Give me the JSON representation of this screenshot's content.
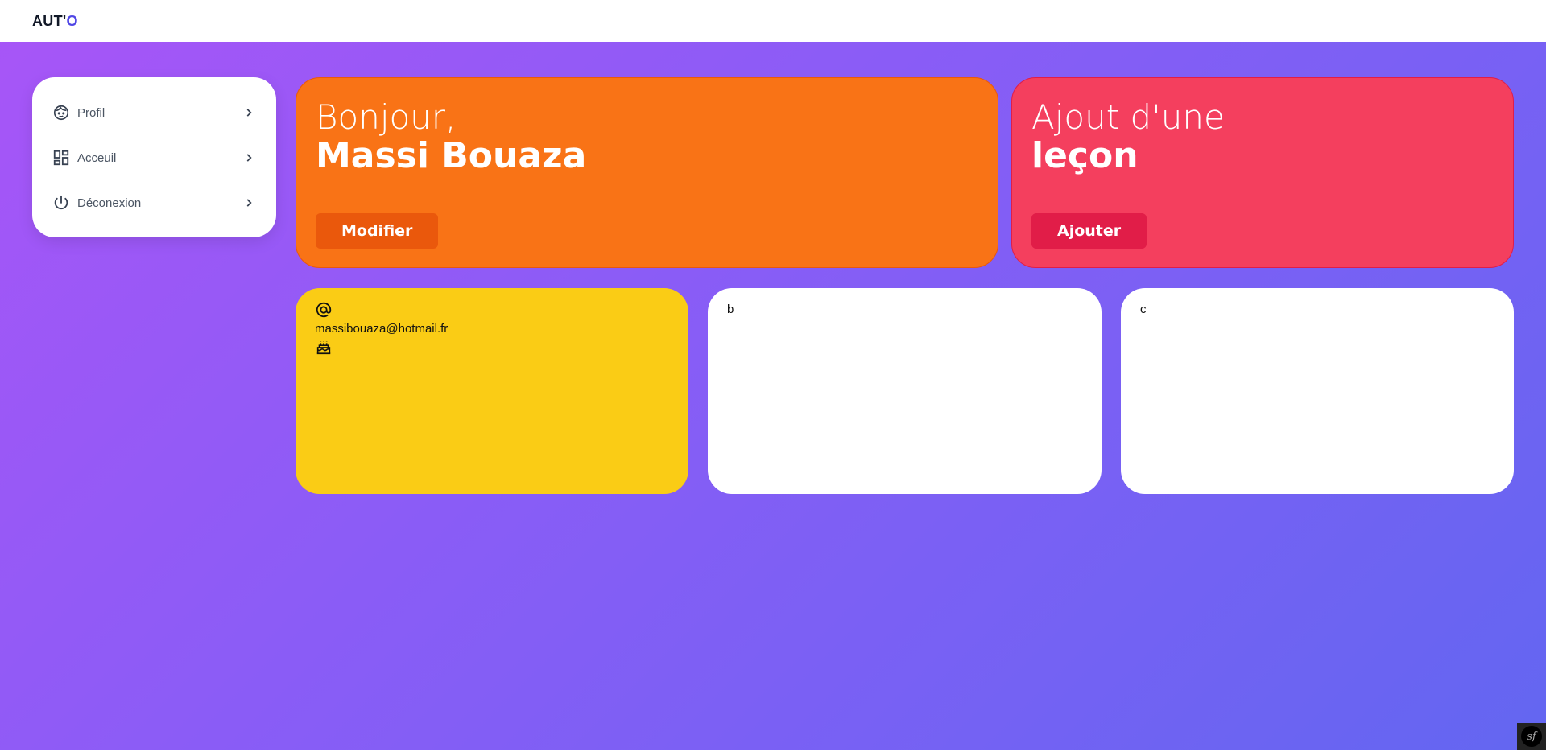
{
  "header": {
    "logo_main": "AUT'",
    "logo_accent": "O"
  },
  "sidebar": {
    "items": [
      {
        "label": "Profil",
        "icon": "face-icon"
      },
      {
        "label": "Acceuil",
        "icon": "dashboard-icon"
      },
      {
        "label": "Déconexion",
        "icon": "power-icon"
      }
    ]
  },
  "greeting": {
    "line1": "Bonjour,",
    "name": "Massi Bouaza",
    "button": "Modifier"
  },
  "lesson": {
    "line1": "Ajout d'une",
    "line2": "leçon",
    "button": "Ajouter"
  },
  "info": {
    "email": "massibouaza@hotmail.fr"
  },
  "card_b": {
    "text": "b"
  },
  "card_c": {
    "text": "c"
  },
  "colors": {
    "orange": "#f97316",
    "red": "#f43f5e",
    "yellow": "#facc15",
    "accent": "#4f46e5"
  }
}
